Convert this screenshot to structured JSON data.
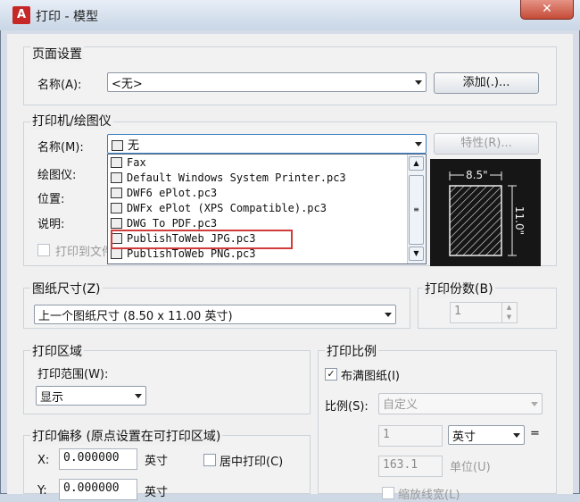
{
  "window": {
    "title": "打印 - 模型",
    "close": "✕",
    "app_icon": "A"
  },
  "page_setup": {
    "group": "页面设置",
    "name_label": "名称(A):",
    "name_value": "<无>",
    "add_button": "添加(.)..."
  },
  "printer": {
    "group": "打印机/绘图仪",
    "name_label": "名称(M):",
    "name_value": "无",
    "properties_button": "特性(R)...",
    "plotter_label": "绘图仪:",
    "location_label": "位置:",
    "description_label": "说明:",
    "print_to_file_label": "打印到文件",
    "dropdown_items": [
      "Fax",
      "Default Windows System Printer.pc3",
      "DWF6 ePlot.pc3",
      "DWFx ePlot (XPS Compatible).pc3",
      "DWG To PDF.pc3",
      "PublishToWeb JPG.pc3",
      "PublishToWeb PNG.pc3"
    ],
    "preview_width": "8.5\"",
    "preview_height": "11.0\""
  },
  "paper_size": {
    "group": "图纸尺寸(Z)",
    "value": "上一个图纸尺寸  (8.50 x 11.00 英寸)"
  },
  "copies": {
    "group": "打印份数(B)",
    "value": "1"
  },
  "plot_area": {
    "group": "打印区域",
    "range_label": "打印范围(W):",
    "range_value": "显示"
  },
  "plot_scale": {
    "group": "打印比例",
    "fit_label": "布满图纸(I)",
    "scale_label": "比例(S):",
    "scale_value": "自定义",
    "value1": "1",
    "unit_value": "英寸",
    "equals": "=",
    "value2": "163.1",
    "unit_label": "单位(U)",
    "lineweight_label": "缩放线宽(L)"
  },
  "plot_offset": {
    "group": "打印偏移 (原点设置在可打印区域)",
    "x_label": "X:",
    "x_value": "0.000000",
    "x_unit": "英寸",
    "center_label": "居中打印(C)",
    "y_label": "Y:",
    "y_value": "0.000000",
    "y_unit": "英寸"
  }
}
